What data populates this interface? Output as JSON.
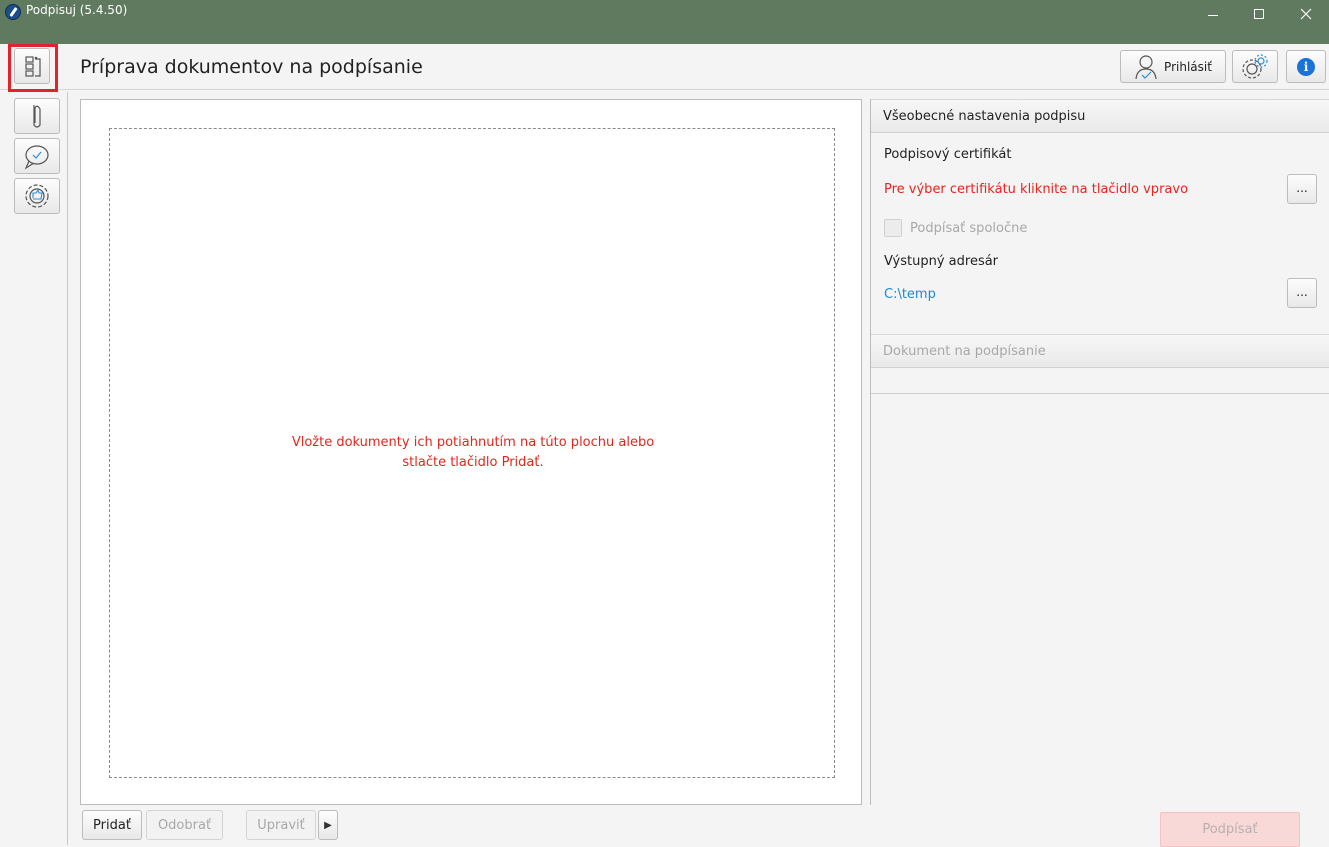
{
  "window": {
    "title": "Podpisuj (5.4.50)"
  },
  "header": {
    "page_title": "Príprava dokumentov na podpísanie",
    "login_label": "Prihlásiť"
  },
  "drop_zone": {
    "message_line1": "Vložte dokumenty ich potiahnutím na túto plochu alebo",
    "message_line2": "stlačte tlačidlo Pridať."
  },
  "bottom_bar": {
    "add_label": "Pridať",
    "remove_label": "Odobrať",
    "edit_label": "Upraviť",
    "sign_label": "Podpísať"
  },
  "settings": {
    "section_title": "Všeobecné nastavenia podpisu",
    "cert_label": "Podpisový certifikát",
    "cert_hint": "Pre výber certifikátu kliknite na tlačidlo vpravo",
    "browse_label": "...",
    "co_sign_label": "Podpísať spoločne",
    "output_dir_label": "Výstupný adresár",
    "output_dir_value": "C:\\temp"
  },
  "document_section": {
    "title": "Dokument na podpísanie"
  },
  "colors": {
    "titlebar": "#5f7a5f",
    "error_text": "#e3261e",
    "link_text": "#1d8ad1",
    "highlight": "#e1232a",
    "sign_button": "#f8d9d8"
  },
  "icons": {
    "app": "feather-logo-icon",
    "toggle": "panel-toggle-icon",
    "login": "user-icon",
    "settings": "gear-icon",
    "info": "info-icon",
    "attachment": "paperclip-icon",
    "comment": "chat-bubble-icon",
    "sign_settings": "signature-settings-icon"
  }
}
